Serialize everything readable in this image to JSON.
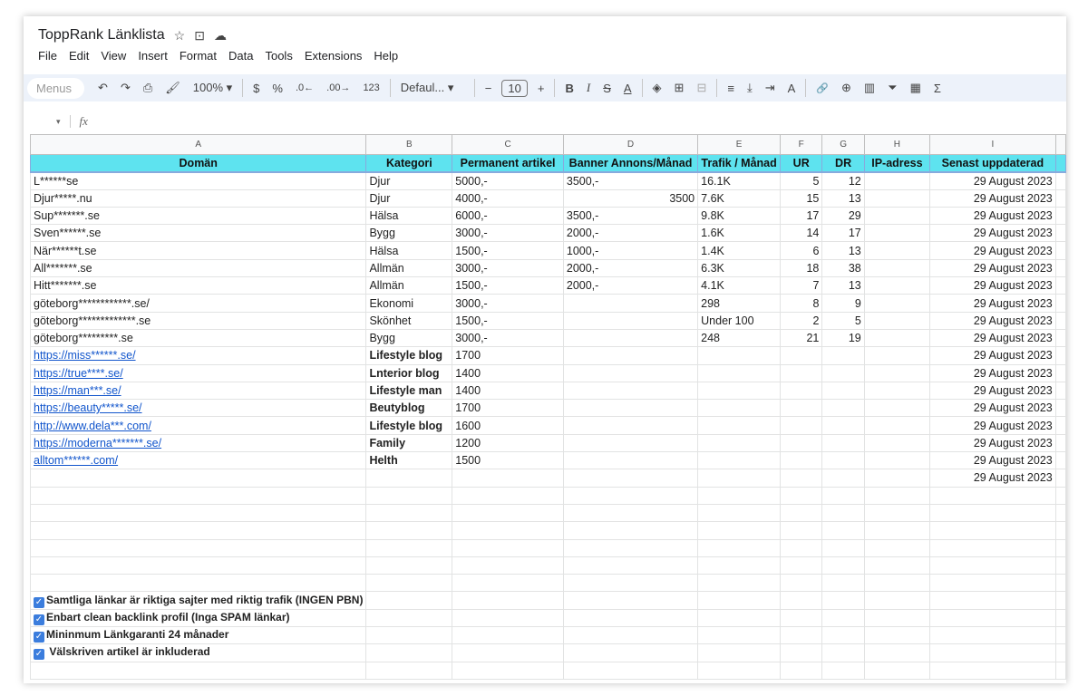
{
  "doc": {
    "title": "ToppRank Länklista",
    "icons": [
      "star-icon",
      "move-to-folder-icon",
      "cloud-saved-icon"
    ]
  },
  "menu": [
    "File",
    "Edit",
    "View",
    "Insert",
    "Format",
    "Data",
    "Tools",
    "Extensions",
    "Help"
  ],
  "toolbar": {
    "menus_placeholder": "Menus",
    "undo": "↶",
    "redo": "↷",
    "print": "⎙",
    "paint": "🖌",
    "zoom": "100%",
    "currency": "$",
    "percent": "%",
    "dec_less": ".0←",
    "dec_more": ".00→",
    "format_123": "123",
    "font": "Defaul...",
    "minus": "−",
    "font_size": "10",
    "plus": "+",
    "bold": "B",
    "italic": "I",
    "strike": "S",
    "text_color": "A",
    "fill": "◈",
    "borders": "⊞",
    "merge": "⊟",
    "align": "≡",
    "valign": "⤓",
    "wrap": "⇥",
    "rotate": "A",
    "link": "🔗",
    "comment": "⊕",
    "chart": "▥",
    "filter": "⏷",
    "table": "▦",
    "sum": "Σ"
  },
  "formula_bar": {
    "fx": "fx",
    "value": ""
  },
  "columns": [
    "A",
    "B",
    "C",
    "D",
    "E",
    "F",
    "G",
    "H",
    "I"
  ],
  "headers": [
    "Domän",
    "Kategori",
    "Permanent artikel",
    "Banner Annons/Månad",
    "Trafik / Månad",
    "UR",
    "DR",
    "IP-adress",
    "Senast uppdaterad"
  ],
  "rows": [
    {
      "cells": [
        "L******se",
        "Djur",
        "5000,-",
        "3500,-",
        "16.1K",
        "5",
        "12",
        "",
        "29 August 2023"
      ]
    },
    {
      "cells": [
        "Djur*****.nu",
        "Djur",
        "4000,-",
        "3500",
        "7.6K",
        "15",
        "13",
        "",
        "29 August 2023"
      ]
    },
    {
      "cells": [
        "Sup*******.se",
        "Hälsa",
        "6000,-",
        "3500,-",
        "9.8K",
        "17",
        "29",
        "",
        "29 August 2023"
      ]
    },
    {
      "cells": [
        "Sven******.se",
        "Bygg",
        "3000,-",
        "2000,-",
        "1.6K",
        "14",
        "17",
        "",
        "29 August 2023"
      ]
    },
    {
      "cells": [
        "När******t.se",
        "Hälsa",
        "1500,-",
        "1000,-",
        "1.4K",
        "6",
        "13",
        "",
        "29 August 2023"
      ]
    },
    {
      "cells": [
        "All*******.se",
        "Allmän",
        "3000,-",
        "2000,-",
        "6.3K",
        "18",
        "38",
        "",
        "29 August 2023"
      ]
    },
    {
      "cells": [
        "Hitt*******.se",
        "Allmän",
        "1500,-",
        "2000,-",
        "4.1K",
        "7",
        "13",
        "",
        "29 August 2023"
      ]
    },
    {
      "cells": [
        "göteborg************.se/",
        "Ekonomi",
        "3000,-",
        "",
        "298",
        "8",
        "9",
        "",
        "29 August 2023"
      ]
    },
    {
      "cells": [
        "göteborg*************.se",
        "Skönhet",
        "1500,-",
        "",
        "Under 100",
        "2",
        "5",
        "",
        "29 August 2023"
      ]
    },
    {
      "cells": [
        "göteborg*********.se",
        "Bygg",
        "3000,-",
        "",
        "248",
        "21",
        "19",
        "",
        "29 August 2023"
      ]
    },
    {
      "link": true,
      "cells": [
        "https://miss******.se/",
        "Lifestyle blog",
        "1700",
        "",
        "",
        "",
        "",
        "",
        "29 August 2023"
      ]
    },
    {
      "link": true,
      "cells": [
        "https://true****.se/",
        "Lnterior blog",
        "1400",
        "",
        "",
        "",
        "",
        "",
        "29 August 2023"
      ]
    },
    {
      "link": true,
      "cells": [
        "https://man***.se/",
        "Lifestyle man",
        "1400",
        "",
        "",
        "",
        "",
        "",
        "29 August 2023"
      ]
    },
    {
      "link": true,
      "cells": [
        "https://beauty*****.se/",
        "Beutyblog",
        "1700",
        "",
        "",
        "",
        "",
        "",
        "29 August 2023"
      ]
    },
    {
      "link": true,
      "cells": [
        "http://www.dela***.com/",
        "Lifestyle blog",
        "1600",
        "",
        "",
        "",
        "",
        "",
        "29 August 2023"
      ]
    },
    {
      "link": true,
      "cells": [
        "https://moderna*******.se/",
        "Family",
        "1200",
        "",
        "",
        "",
        "",
        "",
        "29 August 2023"
      ]
    },
    {
      "link": true,
      "cells": [
        "alltom******.com/",
        "Helth",
        "1500",
        "",
        "",
        "",
        "",
        "",
        "29 August 2023"
      ]
    },
    {
      "cells": [
        "",
        "",
        "",
        "",
        "",
        "",
        "",
        "",
        "29 August 2023"
      ]
    }
  ],
  "checklist": [
    {
      "checked": true,
      "label": "Samtliga länkar är riktiga sajter med riktig trafik (INGEN PBN)"
    },
    {
      "checked": true,
      "label": "Enbart clean backlink profil (Inga SPAM länkar)"
    },
    {
      "checked": true,
      "label": "Mininmum Länkgaranti 24 månader"
    },
    {
      "checked": true,
      "label": " Välskriven artikel är inkluderad"
    }
  ],
  "colors": {
    "header_bg": "#5ee3ef",
    "link": "#1155cc",
    "checkbox": "#3b7ddd"
  }
}
